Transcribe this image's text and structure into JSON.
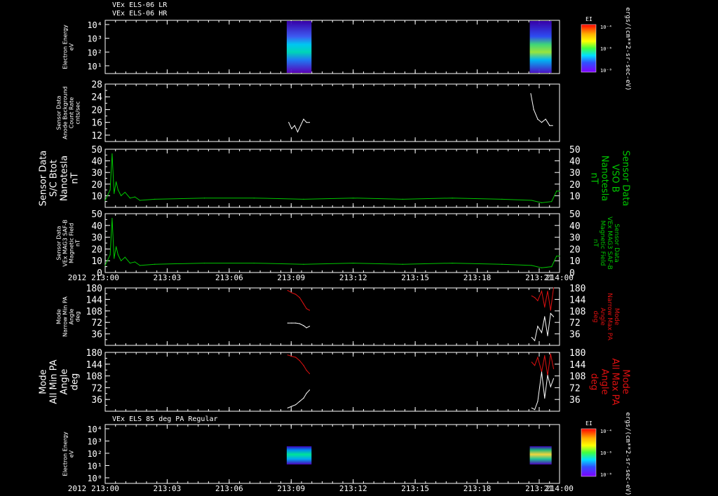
{
  "chart_data": [
    {
      "type": "heatmap",
      "titles": [
        "VEx ELS-06 LR",
        "VEx ELS-06 HR"
      ],
      "ylabel": [
        "Electron Energy",
        "eV"
      ],
      "yticks": [
        "10⁴",
        "10³",
        "10²",
        "10¹"
      ],
      "colorbar": {
        "label": "EI",
        "unit": "ergs/(cm**2-sr-sec-eV)",
        "ticks": [
          "10⁻⁴",
          "10⁻⁶",
          "10⁻⁸"
        ]
      },
      "blocks": [
        {
          "x": [
            213.183,
            213.208
          ]
        },
        {
          "x": [
            213.428,
            213.45
          ]
        }
      ]
    },
    {
      "type": "line",
      "ylabel": [
        "Sensor Data",
        "Anode Background",
        "Count Rate",
        "cnts/sec"
      ],
      "ylim": [
        10,
        28
      ],
      "yticks": [
        {
          "v": 12,
          "t": "12"
        },
        {
          "v": 16,
          "t": "16"
        },
        {
          "v": 20,
          "t": "20"
        },
        {
          "v": 24,
          "t": "24"
        },
        {
          "v": 28,
          "t": "28"
        }
      ],
      "series": [
        {
          "color": "#ffffff",
          "x": [
            213.185,
            213.188,
            213.191,
            213.194,
            213.197,
            213.2,
            213.203,
            213.206
          ],
          "y": [
            16,
            14,
            15,
            13,
            15,
            17,
            16,
            16
          ]
        },
        {
          "color": "#ffffff",
          "x": [
            213.429,
            213.432,
            213.436,
            213.44,
            213.444,
            213.448,
            213.451
          ],
          "y": [
            25,
            20,
            17,
            16,
            17,
            15,
            15
          ]
        }
      ]
    },
    {
      "type": "line",
      "ylabel": [
        "Sensor Data",
        "S/C Btot",
        "Nanotesla",
        "nT"
      ],
      "ylabel_right": [
        "Sensor Data",
        "VSO B",
        "Nanotesla",
        "nT"
      ],
      "ylim": [
        0,
        50
      ],
      "yticks": [
        {
          "v": 10,
          "t": "10"
        },
        {
          "v": 20,
          "t": "20"
        },
        {
          "v": 30,
          "t": "30"
        },
        {
          "v": 40,
          "t": "40"
        },
        {
          "v": 50,
          "t": "50"
        }
      ],
      "series": [
        {
          "color": "#00c800",
          "x": [
            213.0,
            213.005,
            213.007,
            213.009,
            213.011,
            213.013,
            213.016,
            213.02,
            213.025,
            213.03,
            213.035,
            213.05,
            213.1,
            213.15,
            213.2,
            213.25,
            213.3,
            213.35,
            213.4,
            213.43,
            213.44,
            213.45,
            213.455,
            213.458
          ],
          "y": [
            6,
            15,
            46,
            12,
            22,
            15,
            10,
            13,
            8,
            9,
            6,
            7,
            8,
            8,
            7,
            8,
            7,
            8,
            7,
            6,
            4,
            5,
            14,
            14
          ]
        }
      ]
    },
    {
      "type": "line",
      "ylabel": [
        "Sensor Data",
        "VEx MAG3 SAF-B",
        "Magnetic Field",
        "nT"
      ],
      "ylabel_right": [
        "Sensor Data",
        "VEx MAG3 SAF-B",
        "Magnetic Field",
        "nT"
      ],
      "ylim": [
        0,
        50
      ],
      "yticks": [
        {
          "v": 0,
          "t": "0"
        },
        {
          "v": 10,
          "t": "10"
        },
        {
          "v": 20,
          "t": "20"
        },
        {
          "v": 30,
          "t": "30"
        },
        {
          "v": 40,
          "t": "40"
        },
        {
          "v": 50,
          "t": "50"
        }
      ],
      "series": [
        {
          "color": "#00c800",
          "x": [
            213.0,
            213.005,
            213.007,
            213.009,
            213.011,
            213.013,
            213.016,
            213.02,
            213.025,
            213.03,
            213.035,
            213.05,
            213.1,
            213.15,
            213.2,
            213.25,
            213.3,
            213.35,
            213.4,
            213.43,
            213.44,
            213.45,
            213.455,
            213.458
          ],
          "y": [
            6,
            15,
            46,
            12,
            22,
            15,
            10,
            13,
            8,
            9,
            6,
            7,
            8,
            8,
            7,
            8,
            7,
            8,
            7,
            6,
            4,
            5,
            14,
            14
          ]
        }
      ]
    },
    {
      "type": "line",
      "ylabel": [
        "Mode",
        "Narrow Min PA",
        "Angle",
        "deg"
      ],
      "ylabel_right": [
        "Mode",
        "Narrow Max PA",
        "Angle",
        "deg"
      ],
      "ylim": [
        0,
        180
      ],
      "yticks": [
        {
          "v": 36,
          "t": "36"
        },
        {
          "v": 72,
          "t": "72"
        },
        {
          "v": 108,
          "t": "108"
        },
        {
          "v": 144,
          "t": "144"
        },
        {
          "v": 180,
          "t": "180"
        }
      ],
      "series": [
        {
          "color": "#e01010",
          "x": [
            213.184,
            213.188,
            213.192,
            213.196,
            213.2,
            213.203,
            213.206
          ],
          "y": [
            172,
            165,
            160,
            150,
            130,
            115,
            110
          ]
        },
        {
          "color": "#ffffff",
          "x": [
            213.184,
            213.188,
            213.192,
            213.196,
            213.2,
            213.203,
            213.206
          ],
          "y": [
            70,
            70,
            70,
            68,
            62,
            55,
            60
          ]
        },
        {
          "color": "#e01010",
          "x": [
            213.43,
            213.433,
            213.436,
            213.44,
            213.443,
            213.446,
            213.449,
            213.452
          ],
          "y": [
            155,
            150,
            140,
            170,
            120,
            170,
            110,
            180
          ]
        },
        {
          "color": "#ffffff",
          "x": [
            213.43,
            213.433,
            213.436,
            213.44,
            213.443,
            213.446,
            213.449,
            213.452
          ],
          "y": [
            25,
            15,
            60,
            40,
            90,
            30,
            100,
            90
          ]
        }
      ]
    },
    {
      "type": "line",
      "ylabel": [
        "Mode",
        "All Min PA",
        "Angle",
        "deg"
      ],
      "ylabel_right": [
        "Mode",
        "All Max PA",
        "Angle",
        "deg"
      ],
      "ylim": [
        0,
        180
      ],
      "yticks": [
        {
          "v": 36,
          "t": "36"
        },
        {
          "v": 72,
          "t": "72"
        },
        {
          "v": 108,
          "t": "108"
        },
        {
          "v": 144,
          "t": "144"
        },
        {
          "v": 180,
          "t": "180"
        }
      ],
      "series": [
        {
          "color": "#e01010",
          "x": [
            213.184,
            213.188,
            213.192,
            213.196,
            213.2,
            213.203,
            213.206
          ],
          "y": [
            172,
            168,
            165,
            155,
            140,
            125,
            115
          ]
        },
        {
          "color": "#ffffff",
          "x": [
            213.184,
            213.188,
            213.192,
            213.196,
            213.2,
            213.203,
            213.206
          ],
          "y": [
            10,
            15,
            20,
            30,
            40,
            55,
            65
          ]
        },
        {
          "color": "#e01010",
          "x": [
            213.43,
            213.433,
            213.436,
            213.44,
            213.443,
            213.446,
            213.449,
            213.452
          ],
          "y": [
            150,
            140,
            165,
            120,
            170,
            110,
            175,
            130
          ]
        },
        {
          "color": "#ffffff",
          "x": [
            213.43,
            213.433,
            213.436,
            213.44,
            213.443,
            213.446,
            213.449,
            213.452
          ],
          "y": [
            10,
            5,
            30,
            120,
            40,
            110,
            75,
            100
          ]
        }
      ]
    },
    {
      "type": "heatmap",
      "titles": [
        "VEx ELS 85 deg PA Regular"
      ],
      "ylabel": [
        "Electron Energy",
        "eV"
      ],
      "yticks": [
        "10⁴",
        "10³",
        "10²",
        "10¹",
        "10⁰"
      ],
      "colorbar": {
        "label": "EI",
        "unit": "ergs/(cm**2-sr-sec-eV)",
        "ticks": [
          "10⁻⁴",
          "10⁻⁶",
          "10⁻⁸"
        ]
      },
      "blocks": [
        {
          "x": [
            213.183,
            213.208
          ]
        },
        {
          "x": [
            213.428,
            213.45
          ]
        }
      ]
    }
  ],
  "xaxis": {
    "range": [
      213.0,
      213.458
    ],
    "year": "2012",
    "ticks": [
      {
        "v": 213.0,
        "t": "213:00"
      },
      {
        "v": 213.0625,
        "t": "213:03"
      },
      {
        "v": 213.125,
        "t": "213:06"
      },
      {
        "v": 213.1875,
        "t": "213:09"
      },
      {
        "v": 213.25,
        "t": "213:12"
      },
      {
        "v": 213.3125,
        "t": "213:15"
      },
      {
        "v": 213.375,
        "t": "213:18"
      },
      {
        "v": 213.4375,
        "t": "213:21"
      },
      {
        "v": 213.5,
        "t": "214:00"
      }
    ]
  }
}
